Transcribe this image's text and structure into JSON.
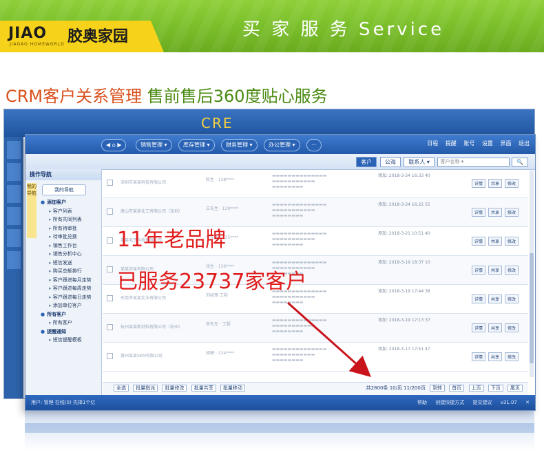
{
  "banner": {
    "logo_main": "JIAO",
    "logo_sub": "JIAOAO HOMEWORLD",
    "logo_cn": "胶奥家园",
    "title": "买 家 服 务  Service"
  },
  "headline": {
    "orange": "CRM客户关系管理",
    "green": " 售前售后360度贴心服务"
  },
  "cre_label": "CRE",
  "app": {
    "nav_menus": [
      "销售管理 ▾",
      "库存管理 ▾",
      "财务管理 ▾",
      "办公管理 ▾",
      "···"
    ],
    "nav_right": [
      "日程",
      "提醒",
      "账号",
      "设置",
      "界面",
      "退出"
    ],
    "tabs": [
      "客户",
      "公海",
      "联系人 ▾"
    ],
    "search_placeholder": "客户名称 ▾",
    "left_panel_title": "操作导航",
    "left_panel_vertical": "我的导航",
    "left_panel_button": "我的导航",
    "left_items": [
      {
        "type": "group",
        "label": "添加客户"
      },
      {
        "type": "sub",
        "label": "客户列表"
      },
      {
        "type": "sub",
        "label": "所有共同列表"
      },
      {
        "type": "sub",
        "label": "所有待审批"
      },
      {
        "type": "sub",
        "label": "待审批兑换"
      },
      {
        "type": "sub",
        "label": "销售工作台"
      },
      {
        "type": "sub",
        "label": "销售分析中心"
      },
      {
        "type": "sub",
        "label": "短信发送"
      },
      {
        "type": "sub",
        "label": "购买总额排行"
      },
      {
        "type": "sub",
        "label": "客户跟进每月走势"
      },
      {
        "type": "sub",
        "label": "客户跟进每周走势"
      },
      {
        "type": "sub",
        "label": "客户跟进每日走势"
      },
      {
        "type": "sub",
        "label": "添加单位客户"
      },
      {
        "type": "group",
        "label": "所有客户"
      },
      {
        "type": "sub",
        "label": "所有客户"
      },
      {
        "type": "group",
        "label": "提醒通知"
      },
      {
        "type": "sub",
        "label": "短信提醒模板"
      }
    ],
    "rows": [
      {
        "company": "深圳市某某科技有限公司",
        "contact": "陈生 · 138****",
        "notes": "添加: 2018-3-24 16:33 40",
        "acts": [
          "详情",
          "共享",
          "修改"
        ]
      },
      {
        "company": "唐山市某某化工有限公司（深圳）",
        "contact": "王先生 · 139****",
        "notes": "添加: 2018-3-24 16:22 55",
        "acts": [
          "详情",
          "共享",
          "修改"
        ]
      },
      {
        "company": "某某电子科技有限公司",
        "contact": "李先生 · 135****",
        "notes": "添加: 2018-3-21 10:51 40",
        "acts": [
          "详情",
          "共享",
          "修改"
        ]
      },
      {
        "company": "某某贸易有限公司",
        "contact": "张生 · 136****",
        "notes": "添加: 2018-3-19 18:37 10",
        "acts": [
          "详情",
          "共享",
          "修改"
        ]
      },
      {
        "company": "东莞市某某实业有限公司",
        "contact": "刘经理 工程",
        "notes": "添加: 2018-3-19 17:44 38",
        "acts": [
          "详情",
          "共享",
          "修改"
        ]
      },
      {
        "company": "杭州某某新材料有限公司（杭州）",
        "contact": "宋先生 · 工程",
        "notes": "添加: 2018-3-19 17:13 37",
        "acts": [
          "详情",
          "共享",
          "修改"
        ]
      },
      {
        "company": "惠州某某SKM有限公司",
        "contact": "胡健 · 134****",
        "notes": "添加: 2018-3-17 17:51 47",
        "acts": [
          "详情",
          "共享",
          "修改"
        ]
      }
    ],
    "footer_left": [
      "全选",
      "批量指派",
      "批量修改",
      "批量共享",
      "批量移动"
    ],
    "footer_right_text": "共2800条  10/页  11/200页",
    "footer_right_buttons": [
      "到转",
      "首页",
      "上页",
      "下页",
      "尾页"
    ],
    "status_left": "用户: 管理    在线(0)    先择1个亿",
    "status_right": [
      "帮助",
      "创建快捷方式",
      "提交建议",
      "v31.07"
    ]
  },
  "overlay": {
    "line1": "11年老品牌",
    "line2": "已服务23737家客户"
  },
  "colors": {
    "banner_green": "#7cc12c",
    "logo_yellow": "#f6d21a",
    "headline_orange": "#d9501b",
    "headline_green": "#4a8a12",
    "app_blue": "#2459a8",
    "overlay_red": "#e01b1b"
  }
}
